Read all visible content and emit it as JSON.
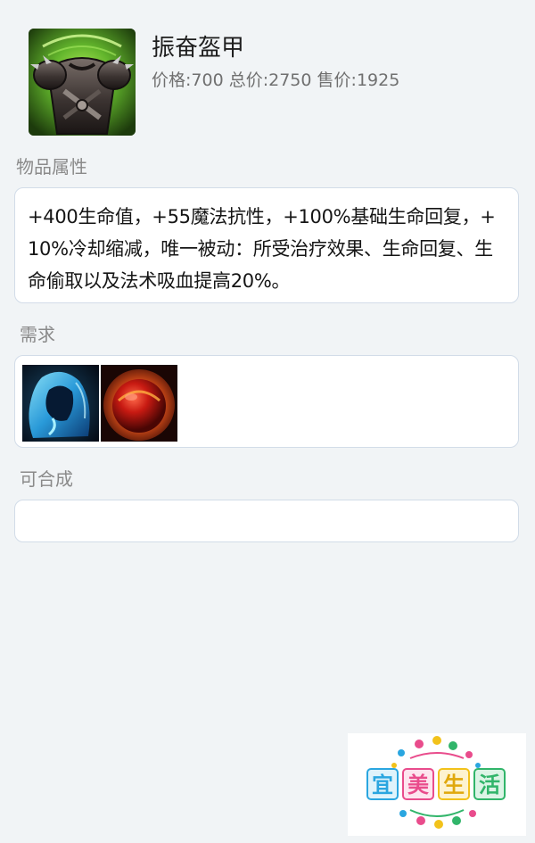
{
  "item": {
    "name": "振奋盔甲",
    "price_label": "价格:",
    "price": "700",
    "total_label": "总价:",
    "total": "2750",
    "sell_label": "售价:",
    "sell": "1925",
    "icon": "armor-icon"
  },
  "attributes": {
    "title": "物品属性",
    "text": "+400生命值，+55魔法抗性，+100%基础生命回复，+10%冷却缩减，唯一被动：所受治疗效果、生命回复、生命偷取以及法术吸血提高20%。"
  },
  "requirements": {
    "title": "需求",
    "items": [
      {
        "icon": "blue-cloak-icon",
        "color": "#2aa8e8"
      },
      {
        "icon": "red-orb-icon",
        "color": "#d8341c"
      }
    ]
  },
  "craftable": {
    "title": "可合成",
    "items": []
  },
  "watermark": {
    "chars": [
      "宜",
      "美",
      "生",
      "活"
    ],
    "colors": [
      "#2aa6e0",
      "#e94c8c",
      "#f2c21b",
      "#31b56a"
    ]
  }
}
